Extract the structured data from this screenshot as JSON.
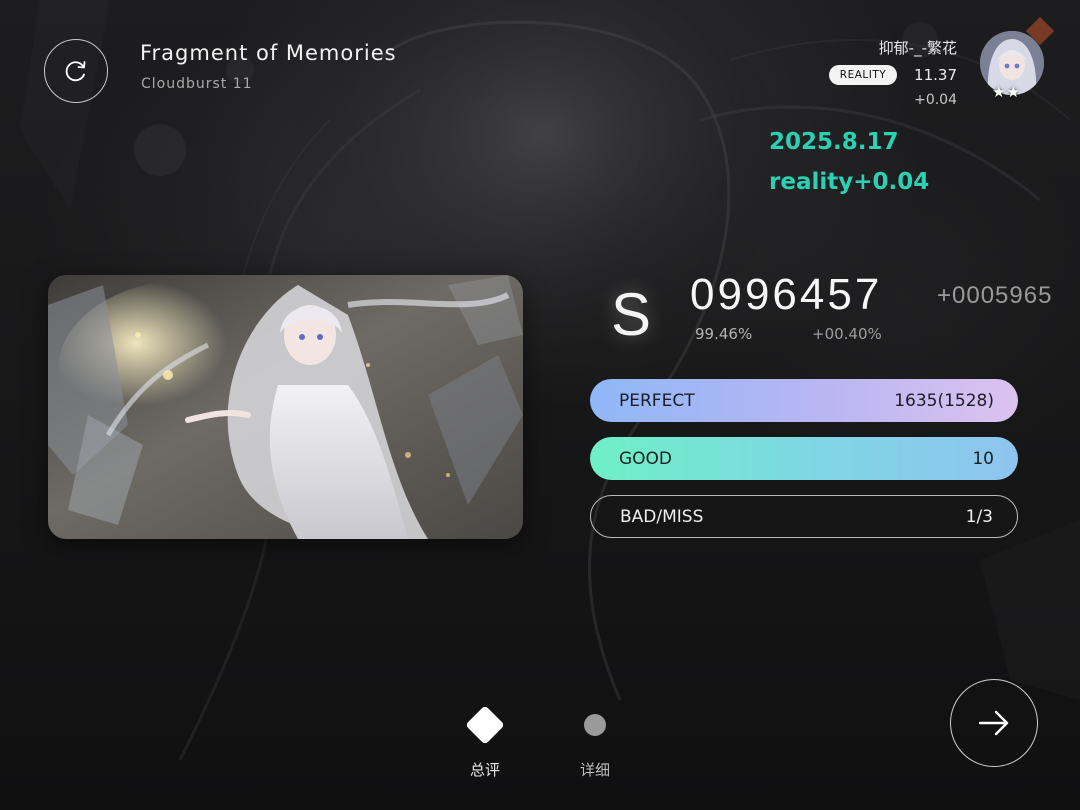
{
  "header": {
    "song_title": "Fragment of Memories",
    "song_level": "Cloudburst 11"
  },
  "player": {
    "name": "抑郁-_-繁花",
    "rank_label": "REALITY",
    "rks": "11.37",
    "rks_delta": "+0.04",
    "stars": "★★"
  },
  "annotation": {
    "date": "2025.8.17",
    "reality_delta": "reality+0.04",
    "color": "#2ad1b4"
  },
  "result": {
    "grade": "S",
    "score": "0996457",
    "score_delta": "+0005965",
    "accuracy": "99.46%",
    "accuracy_delta": "+00.40%"
  },
  "judgements": {
    "perfect": {
      "label": "PERFECT",
      "value": "1635(1528)"
    },
    "good": {
      "label": "GOOD",
      "value": "10"
    },
    "bad_miss": {
      "label": "BAD/MISS",
      "value": "1/3"
    }
  },
  "nav": {
    "tab_total": "总评",
    "tab_detail": "详细"
  },
  "icons": {
    "retry": "retry-icon",
    "next": "arrow-right-icon",
    "tab_total": "diamond-icon",
    "tab_detail": "dot-icon"
  }
}
